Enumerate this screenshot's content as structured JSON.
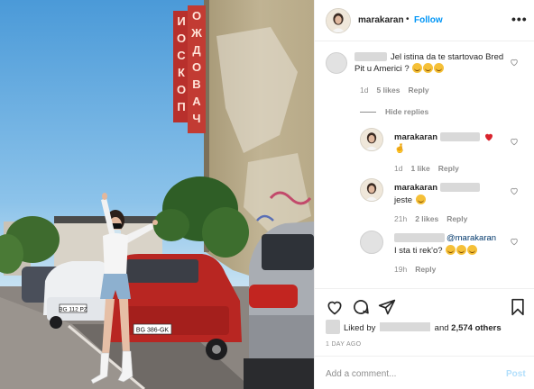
{
  "post": {
    "sign_text": [
      "О",
      "Ж",
      "Д",
      "О",
      "В",
      "А",
      "Ч"
    ],
    "sign_text_left": [
      "И",
      "О",
      "С",
      "К",
      "О",
      "П"
    ],
    "plate_left": "BG 112 PZ",
    "plate_right": "BG 386-GK"
  },
  "header": {
    "username": "marakaran",
    "dot": "•",
    "follow_label": "Follow",
    "more_label": "•••"
  },
  "comments": [
    {
      "text": "Jel istina da te startovao Bred Pit u Americi ?",
      "emojis": 3,
      "time": "1d",
      "likes": "5 likes",
      "reply": "Reply"
    }
  ],
  "hide_replies_label": "Hide replies",
  "replies": [
    {
      "username": "marakaran",
      "emoji_note": "🤞",
      "time": "1d",
      "likes": "1 like",
      "reply": "Reply",
      "liked": true
    },
    {
      "username": "marakaran",
      "text": "jeste",
      "time": "21h",
      "likes": "2 likes",
      "reply": "Reply"
    },
    {
      "mention": "@marakaran",
      "text": "I sta ti rek'o?",
      "emojis": 3,
      "time": "19h",
      "reply": "Reply"
    }
  ],
  "actions": {
    "liked_prefix": "Liked by",
    "liked_and": "and",
    "liked_count": "2,574 others",
    "time_ago": "1 DAY AGO",
    "add_comment_placeholder": "Add a comment...",
    "post_label": "Post"
  },
  "colors": {
    "follow": "#0095f6",
    "post_disabled": "#b2dffc",
    "liked_heart": "#ed4956",
    "muted": "#8e8e8e"
  },
  "icons": {
    "like": "heart-icon",
    "comment": "comment-icon",
    "share": "send-icon",
    "save": "bookmark-icon",
    "more": "more-icon"
  }
}
